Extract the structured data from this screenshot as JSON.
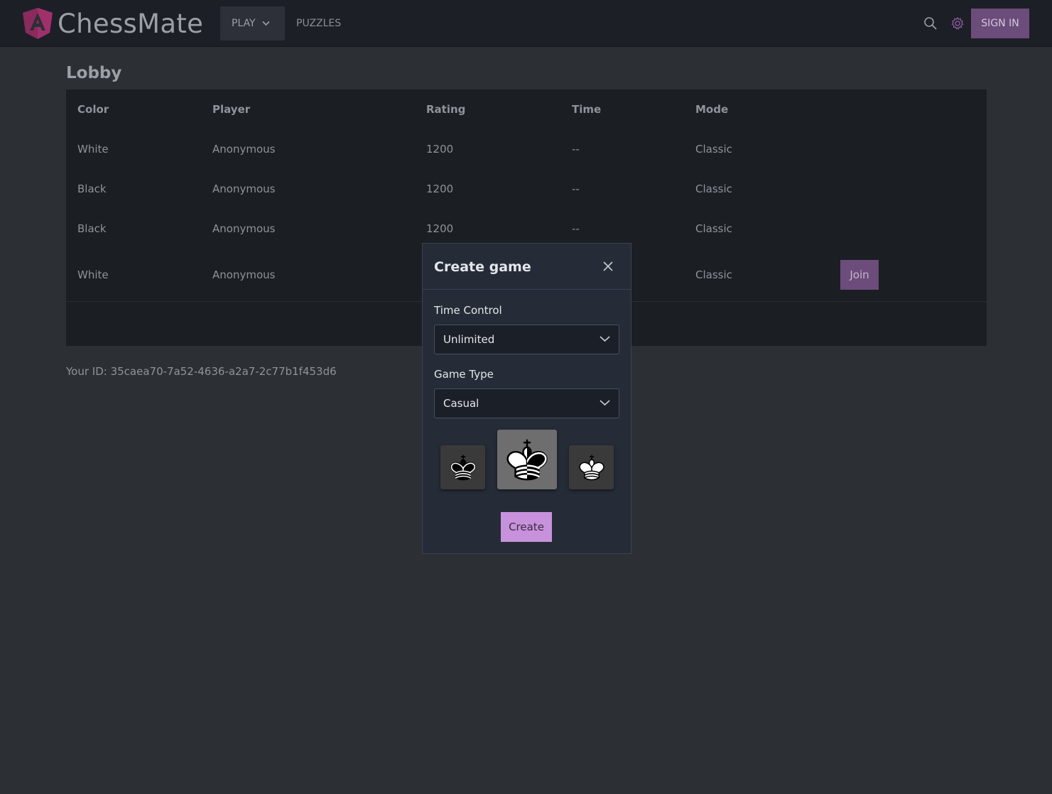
{
  "app": {
    "brand": "ChessMate"
  },
  "nav": {
    "play_label": "PLAY",
    "puzzles_label": "PUZZLES",
    "signin_label": "SIGN IN"
  },
  "lobby": {
    "title": "Lobby",
    "columns": [
      "Color",
      "Player",
      "Rating",
      "Time",
      "Mode"
    ],
    "rows": [
      {
        "color": "White",
        "player": "Anonymous",
        "rating": "1200",
        "time": "--",
        "mode": "Classic"
      },
      {
        "color": "Black",
        "player": "Anonymous",
        "rating": "1200",
        "time": "--",
        "mode": "Classic"
      },
      {
        "color": "Black",
        "player": "Anonymous",
        "rating": "1200",
        "time": "--",
        "mode": "Classic"
      },
      {
        "color": "White",
        "player": "Anonymous",
        "rating": "",
        "time": "",
        "mode": "Classic",
        "action": "Join"
      }
    ]
  },
  "your_id": "Your ID: 35caea70-7a52-4636-a2a7-2c77b1f453d6",
  "dialog": {
    "title": "Create game",
    "time_control_label": "Time Control",
    "time_control_value": "Unlimited",
    "game_type_label": "Game Type",
    "game_type_value": "Casual",
    "color_choices": [
      "black-king-icon",
      "half-king-icon",
      "white-king-icon"
    ],
    "selected_color": "random",
    "create_label": "Create"
  },
  "colors": {
    "accent": "#6b4c7a",
    "create": "#c792db",
    "topbar": "#1c1f25",
    "background": "#2c2f34"
  }
}
